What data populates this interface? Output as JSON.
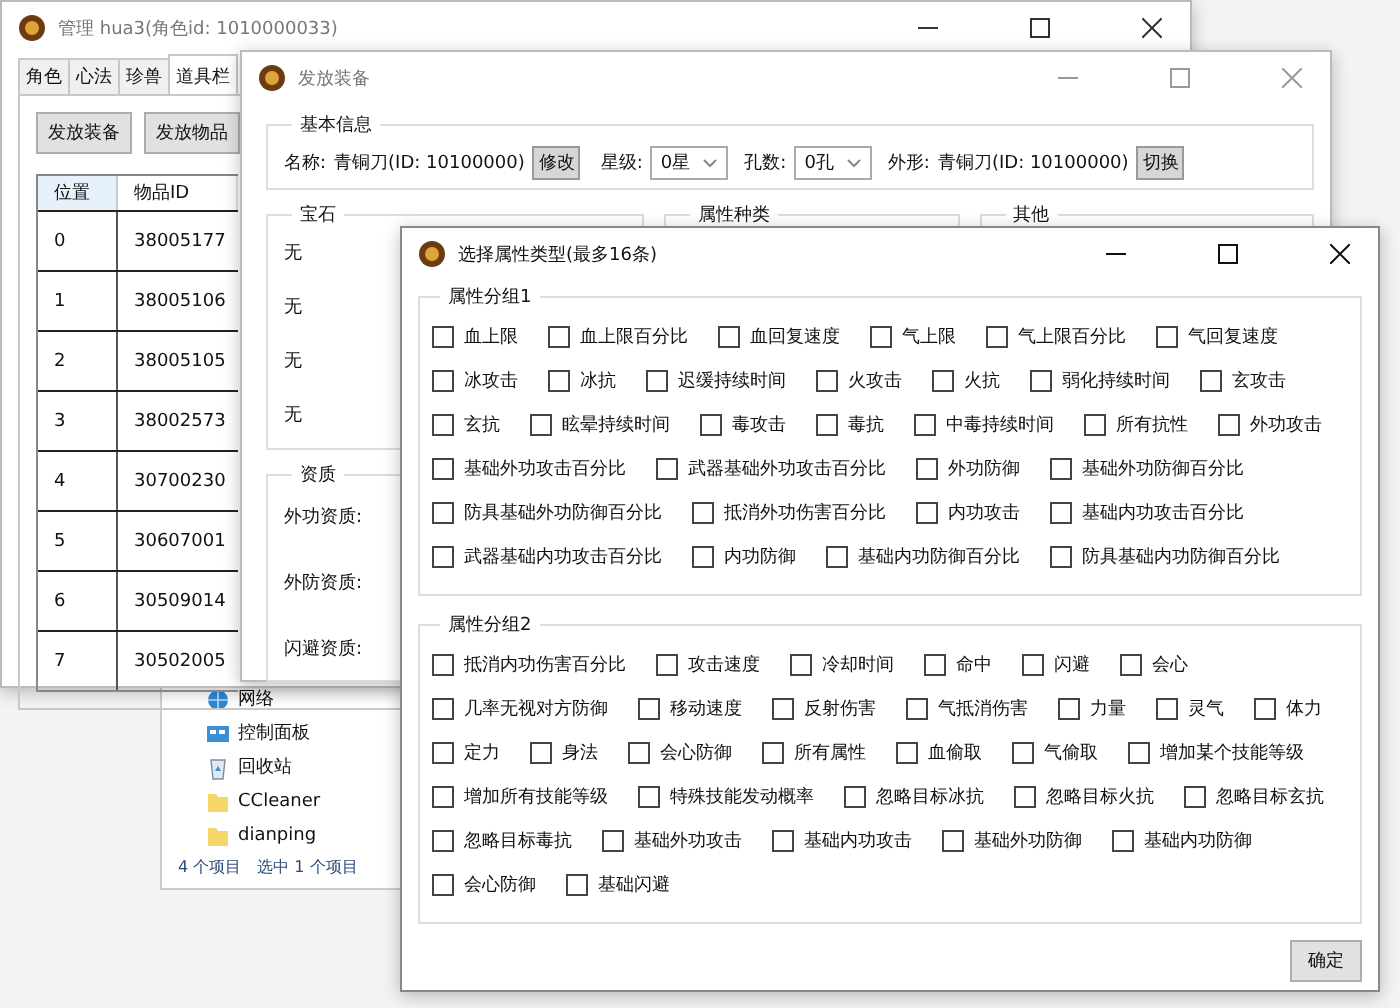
{
  "explorer": {
    "items": [
      {
        "label": "网络",
        "kind": "network"
      },
      {
        "label": "控制面板",
        "kind": "control-panel"
      },
      {
        "label": "回收站",
        "kind": "recycle-bin"
      },
      {
        "label": "CCleaner",
        "kind": "folder"
      },
      {
        "label": "dianping",
        "kind": "folder"
      }
    ],
    "status": [
      "4 个项目",
      "选中 1 个项目"
    ]
  },
  "manage_window": {
    "title": "管理 hua3(角色id: 1010000033)",
    "tabs": [
      {
        "label": "角色",
        "selected": false
      },
      {
        "label": "心法",
        "selected": false
      },
      {
        "label": "珍兽",
        "selected": false
      },
      {
        "label": "道具栏",
        "selected": true
      }
    ],
    "buttons": [
      "发放装备",
      "发放物品"
    ],
    "table": {
      "columns": [
        "位置",
        "物品ID"
      ],
      "rows": [
        [
          "0",
          "38005177"
        ],
        [
          "1",
          "38005106"
        ],
        [
          "2",
          "38005105"
        ],
        [
          "3",
          "38002573"
        ],
        [
          "4",
          "30700230"
        ],
        [
          "5",
          "30607001"
        ],
        [
          "6",
          "30509014"
        ],
        [
          "7",
          "30502005"
        ]
      ]
    }
  },
  "equip_window": {
    "title": "发放装备",
    "basic_info": {
      "legend": "基本信息",
      "name_label": "名称:",
      "name_value": "青铜刀(ID: 10100000)",
      "modify_button": "修改",
      "star_label": "星级:",
      "star_value": "0星",
      "holes_label": "孔数:",
      "holes_value": "0孔",
      "look_label": "外形:",
      "look_value": "青铜刀(ID: 10100000)",
      "switch_button": "切换"
    },
    "gems": {
      "legend": "宝石",
      "items": [
        "无",
        "无",
        "无",
        "无"
      ]
    },
    "attr_types": {
      "legend": "属性种类"
    },
    "other": {
      "legend": "其他"
    },
    "aptitude": {
      "legend": "资质",
      "labels": [
        "外功资质:",
        "外防资质:",
        "闪避资质:"
      ]
    }
  },
  "attr_dialog": {
    "title": "选择属性类型(最多16条)",
    "groups": [
      {
        "legend": "属性分组1",
        "items": [
          {
            "label": "血上限",
            "checked": false
          },
          {
            "label": "血上限百分比",
            "checked": false
          },
          {
            "label": "血回复速度",
            "checked": false
          },
          {
            "label": "气上限",
            "checked": false
          },
          {
            "label": "气上限百分比",
            "checked": false
          },
          {
            "label": "气回复速度",
            "checked": false
          },
          {
            "label": "冰攻击",
            "checked": false
          },
          {
            "label": "冰抗",
            "checked": false
          },
          {
            "label": "迟缓持续时间",
            "checked": false
          },
          {
            "label": "火攻击",
            "checked": false
          },
          {
            "label": "火抗",
            "checked": false
          },
          {
            "label": "弱化持续时间",
            "checked": false
          },
          {
            "label": "玄攻击",
            "checked": false
          },
          {
            "label": "玄抗",
            "checked": false
          },
          {
            "label": "眩晕持续时间",
            "checked": false
          },
          {
            "label": "毒攻击",
            "checked": false
          },
          {
            "label": "毒抗",
            "checked": false
          },
          {
            "label": "中毒持续时间",
            "checked": false
          },
          {
            "label": "所有抗性",
            "checked": false
          },
          {
            "label": "外功攻击",
            "checked": false
          },
          {
            "label": "基础外功攻击百分比",
            "checked": false
          },
          {
            "label": "武器基础外功攻击百分比",
            "checked": false
          },
          {
            "label": "外功防御",
            "checked": false
          },
          {
            "label": "基础外功防御百分比",
            "checked": false
          },
          {
            "label": "防具基础外功防御百分比",
            "checked": false
          },
          {
            "label": "抵消外功伤害百分比",
            "checked": false
          },
          {
            "label": "内功攻击",
            "checked": false
          },
          {
            "label": "基础内功攻击百分比",
            "checked": false
          },
          {
            "label": "武器基础内功攻击百分比",
            "checked": false
          },
          {
            "label": "内功防御",
            "checked": false
          },
          {
            "label": "基础内功防御百分比",
            "checked": false
          },
          {
            "label": "防具基础内功防御百分比",
            "checked": false
          }
        ]
      },
      {
        "legend": "属性分组2",
        "items": [
          {
            "label": "抵消内功伤害百分比",
            "checked": false
          },
          {
            "label": "攻击速度",
            "checked": false
          },
          {
            "label": "冷却时间",
            "checked": false
          },
          {
            "label": "命中",
            "checked": false
          },
          {
            "label": "闪避",
            "checked": false
          },
          {
            "label": "会心",
            "checked": false
          },
          {
            "label": "几率无视对方防御",
            "checked": false
          },
          {
            "label": "移动速度",
            "checked": false
          },
          {
            "label": "反射伤害",
            "checked": false
          },
          {
            "label": "气抵消伤害",
            "checked": false
          },
          {
            "label": "力量",
            "checked": false
          },
          {
            "label": "灵气",
            "checked": false
          },
          {
            "label": "体力",
            "checked": false
          },
          {
            "label": "定力",
            "checked": false
          },
          {
            "label": "身法",
            "checked": false
          },
          {
            "label": "会心防御",
            "checked": false
          },
          {
            "label": "所有属性",
            "checked": false
          },
          {
            "label": "血偷取",
            "checked": false
          },
          {
            "label": "气偷取",
            "checked": false
          },
          {
            "label": "增加某个技能等级",
            "checked": false
          },
          {
            "label": "增加所有技能等级",
            "checked": false
          },
          {
            "label": "特殊技能发动概率",
            "checked": false
          },
          {
            "label": "忽略目标冰抗",
            "checked": false
          },
          {
            "label": "忽略目标火抗",
            "checked": false
          },
          {
            "label": "忽略目标玄抗",
            "checked": false
          },
          {
            "label": "忽略目标毒抗",
            "checked": false
          },
          {
            "label": "基础外功攻击",
            "checked": false
          },
          {
            "label": "基础内功攻击",
            "checked": false
          },
          {
            "label": "基础外功防御",
            "checked": false
          },
          {
            "label": "基础内功防御",
            "checked": false
          },
          {
            "label": "会心防御",
            "checked": false
          },
          {
            "label": "基础闪避",
            "checked": false
          }
        ]
      }
    ],
    "ok_button": "确定"
  }
}
